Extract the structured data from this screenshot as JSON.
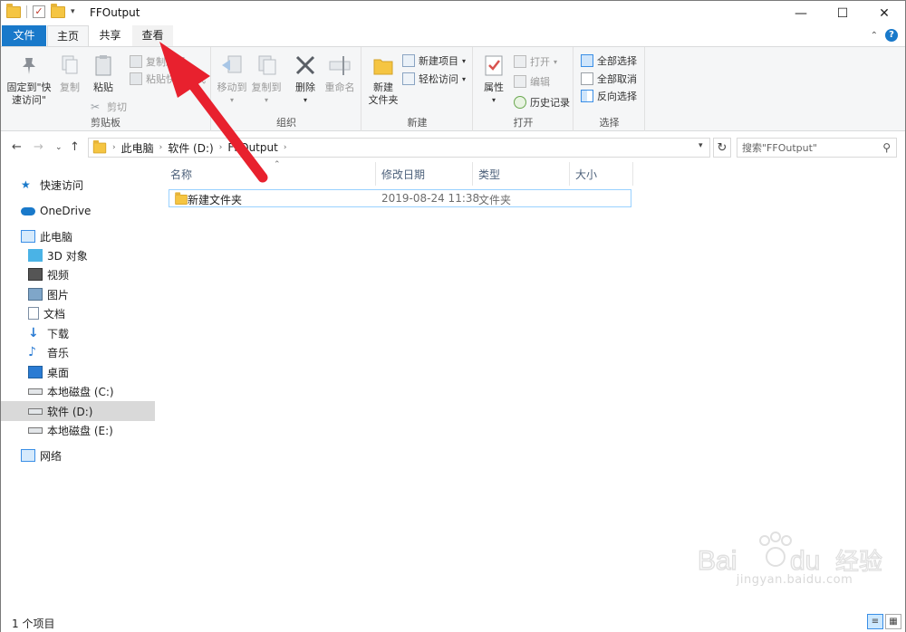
{
  "window": {
    "title": "FFOutput",
    "controls": {
      "minimize": "—",
      "maximize": "☐",
      "close": "✕"
    }
  },
  "ribbon_tabs": {
    "file": "文件",
    "home": "主页",
    "share": "共享",
    "view": "查看"
  },
  "ribbon": {
    "clipboard": {
      "label": "剪贴板",
      "pin": "固定到\"快\n速访问\"",
      "copy": "复制",
      "paste": "粘贴",
      "copy_path": "复制路径",
      "paste_shortcut": "粘贴快捷方式",
      "cut": "剪切"
    },
    "organize": {
      "label": "组织",
      "move_to": "移动到",
      "copy_to": "复制到",
      "delete": "删除",
      "rename": "重命名"
    },
    "new": {
      "label": "新建",
      "new_folder": "新建\n文件夹",
      "new_item": "新建项目",
      "easy_access": "轻松访问"
    },
    "open": {
      "label": "打开",
      "properties": "属性",
      "open": "打开",
      "edit": "编辑",
      "history": "历史记录"
    },
    "select": {
      "label": "选择",
      "select_all": "全部选择",
      "select_none": "全部取消",
      "invert": "反向选择"
    }
  },
  "address": {
    "crumbs": [
      "此电脑",
      "软件 (D:)",
      "FFOutput"
    ],
    "search_placeholder": "搜索\"FFOutput\""
  },
  "navpane": {
    "quick_access": "快速访问",
    "onedrive": "OneDrive",
    "this_pc": "此电脑",
    "items": [
      "3D 对象",
      "视频",
      "图片",
      "文档",
      "下载",
      "音乐",
      "桌面",
      "本地磁盘 (C:)",
      "软件 (D:)",
      "本地磁盘 (E:)"
    ],
    "network": "网络"
  },
  "filelist": {
    "columns": [
      "名称",
      "修改日期",
      "类型",
      "大小"
    ],
    "rows": [
      {
        "name": "新建文件夹",
        "modified": "2019-08-24 11:38",
        "type": "文件夹",
        "size": ""
      }
    ]
  },
  "status": {
    "count": "1 个项目"
  },
  "watermark": {
    "text": "jingyan.baidu.com"
  },
  "colors": {
    "file_tab": "#1979ca",
    "arrow": "#e8212e",
    "selection": "#cce8ff"
  }
}
